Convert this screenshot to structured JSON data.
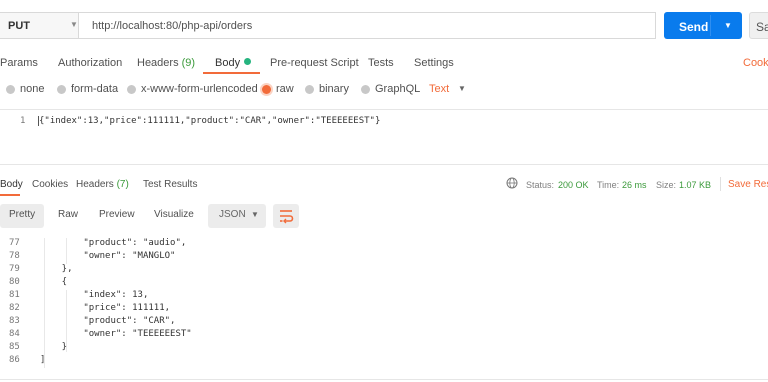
{
  "request": {
    "method": "PUT",
    "url": "http://localhost:80/php-api/orders",
    "send_label": "Send",
    "save_label": "Sav"
  },
  "request_tabs": {
    "params": "Params",
    "authorization": "Authorization",
    "headers": "Headers",
    "headers_count": "(9)",
    "body": "Body",
    "prerequest": "Pre-request Script",
    "tests": "Tests",
    "settings": "Settings",
    "cookies": "Cooki"
  },
  "body_types": {
    "none": "none",
    "form_data": "form-data",
    "urlencoded": "x-www-form-urlencoded",
    "raw": "raw",
    "binary": "binary",
    "graphql": "GraphQL",
    "text_type": "Text"
  },
  "request_editor": {
    "line_number": "1",
    "content": "{\"index\":13,\"price\":111111,\"product\":\"CAR\",\"owner\":\"TEEEEEEST\"}"
  },
  "response_tabs": {
    "body": "Body",
    "cookies": "Cookies",
    "headers": "Headers",
    "headers_count": "(7)",
    "test_results": "Test Results"
  },
  "response_status": {
    "status_label": "Status:",
    "status_value": "200 OK",
    "time_label": "Time:",
    "time_value": "26 ms",
    "size_label": "Size:",
    "size_value": "1.07 KB",
    "save_response": "Save Resp"
  },
  "view_toolbar": {
    "pretty": "Pretty",
    "raw": "Raw",
    "preview": "Preview",
    "visualize": "Visualize",
    "format": "JSON"
  },
  "response_lines": [
    {
      "num": "77",
      "text": "        \"product\": \"audio\","
    },
    {
      "num": "78",
      "text": "        \"owner\": \"MANGLO\""
    },
    {
      "num": "79",
      "text": "    },"
    },
    {
      "num": "80",
      "text": "    {"
    },
    {
      "num": "81",
      "text": "        \"index\": 13,"
    },
    {
      "num": "82",
      "text": "        \"price\": 111111,"
    },
    {
      "num": "83",
      "text": "        \"product\": \"CAR\","
    },
    {
      "num": "84",
      "text": "        \"owner\": \"TEEEEEEST\""
    },
    {
      "num": "85",
      "text": "    }"
    },
    {
      "num": "86",
      "text": "]"
    }
  ],
  "colors": {
    "accent": "#f26b3a",
    "send_blue": "#097bed",
    "status_green": "#3b9a3b",
    "body_dot": "#26b47f"
  }
}
